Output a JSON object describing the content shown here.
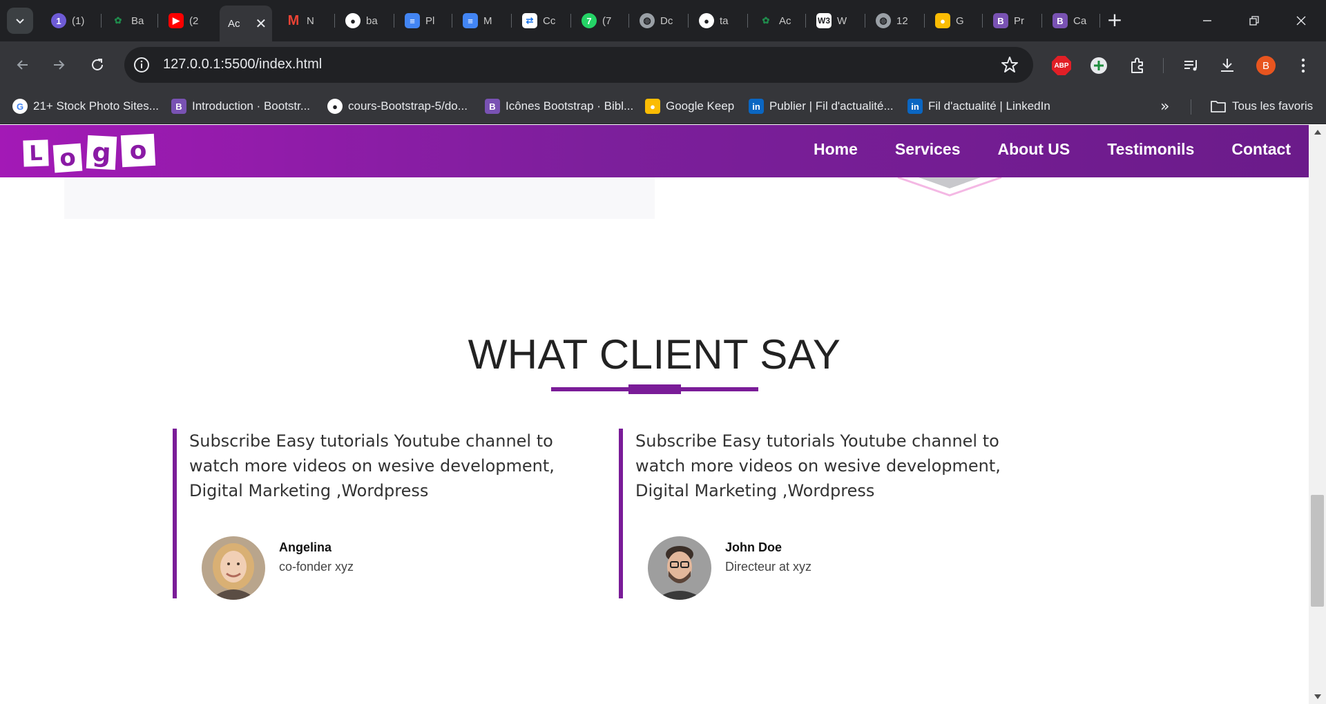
{
  "browser": {
    "tabs": [
      {
        "title": "(1)",
        "icon": "gmail-notification-icon",
        "color": "#6e5bd6"
      },
      {
        "title": "Ba",
        "icon": "sheets-leaf-icon",
        "color": "#1f8b4c"
      },
      {
        "title": "(2",
        "icon": "youtube-icon",
        "color": "#ff0000"
      },
      {
        "title": "Ac",
        "icon": "active-tab",
        "color": "#35363a",
        "active": true
      },
      {
        "title": "N",
        "icon": "gmail-icon",
        "color": "#ea4335"
      },
      {
        "title": "ba",
        "icon": "github-icon",
        "color": "#ffffff"
      },
      {
        "title": "Pl",
        "icon": "docs-icon",
        "color": "#4285f4"
      },
      {
        "title": "M",
        "icon": "docs-icon",
        "color": "#4285f4"
      },
      {
        "title": "Cc",
        "icon": "translate-icon",
        "color": "#1a73e8"
      },
      {
        "title": "(7",
        "icon": "whatsapp-icon",
        "color": "#25d366"
      },
      {
        "title": "Dc",
        "icon": "globe-icon",
        "color": "#9aa0a6"
      },
      {
        "title": "ta",
        "icon": "github-icon",
        "color": "#ffffff"
      },
      {
        "title": "Ac",
        "icon": "leaf-icon",
        "color": "#1f8b4c"
      },
      {
        "title": "W",
        "icon": "w3schools-icon",
        "color": "#ffffff"
      },
      {
        "title": "12",
        "icon": "globe-icon",
        "color": "#9aa0a6"
      },
      {
        "title": "G",
        "icon": "keep-icon",
        "color": "#fbbc04"
      },
      {
        "title": "Pr",
        "icon": "bootstrap-icon",
        "color": "#7952b3"
      },
      {
        "title": "Ca",
        "icon": "bootstrap-icon",
        "color": "#7952b3"
      }
    ],
    "url": "127.0.0.1:5500/index.html",
    "profile_initial": "B",
    "abp_label": "ABP",
    "bookmarks": [
      {
        "label": "21+ Stock Photo Sites...",
        "icon": "google-icon",
        "color": "#ffffff"
      },
      {
        "label": "Introduction · Bootstr...",
        "icon": "bootstrap-icon",
        "color": "#7952b3"
      },
      {
        "label": "cours-Bootstrap-5/do...",
        "icon": "github-icon",
        "color": "#ffffff"
      },
      {
        "label": "Icônes Bootstrap · Bibl...",
        "icon": "bootstrap-icon",
        "color": "#7952b3"
      },
      {
        "label": "Google Keep",
        "icon": "keep-icon",
        "color": "#fbbc04"
      },
      {
        "label": "Publier | Fil d'actualité...",
        "icon": "linkedin-icon",
        "color": "#0a66c2"
      },
      {
        "label": "Fil d'actualité | LinkedIn",
        "icon": "linkedin-icon",
        "color": "#0a66c2"
      }
    ],
    "all_bookmarks_label": "Tous les favoris"
  },
  "site": {
    "logo_letters": [
      "L",
      "o",
      "g",
      "o"
    ],
    "nav": [
      "Home",
      "Services",
      "About US",
      "Testimonils",
      "Contact"
    ],
    "accent_color": "#7a1c98"
  },
  "testimonials": {
    "title": "WHAT CLIENT SAY",
    "items": [
      {
        "text": "Subscribe Easy tutorials Youtube channel to watch more videos on wesive development, Digital Marketing ,Wordpress",
        "name": "Angelina",
        "role": "co-fonder xyz"
      },
      {
        "text": "Subscribe Easy tutorials Youtube channel to watch more videos on wesive development, Digital Marketing ,Wordpress",
        "name": "John Doe",
        "role": "Directeur at xyz"
      }
    ]
  }
}
